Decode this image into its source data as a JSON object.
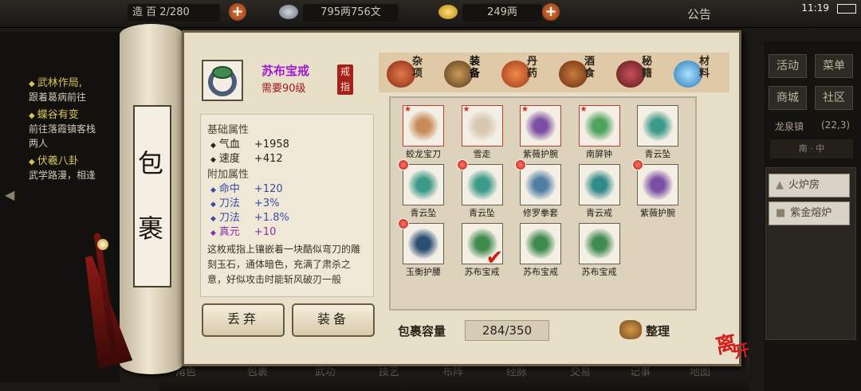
{
  "topbar": {
    "title_partial": "造 百",
    "capacity_partial": "2/280",
    "money": "795两756文",
    "gold": "249两",
    "announcement": "公告",
    "time": "11:19"
  },
  "quests": [
    {
      "title": "武林作局,",
      "desc": "跟着葛病前往"
    },
    {
      "title": "蝶谷有变",
      "desc": "前往落霞镇客栈",
      "desc2": "两人"
    },
    {
      "title": "伏羲八卦",
      "desc": "武学路漫，相逢"
    }
  ],
  "right_panel": {
    "buttons": [
      "活动",
      "菜单",
      "商城",
      "社区"
    ],
    "town": "龙泉镇",
    "town_coords": "(22,3)",
    "compass_south": "南",
    "compass_mid": "中",
    "slots": [
      "火炉房",
      "紫金熔炉"
    ]
  },
  "bottom_nav": [
    "角色",
    "包裹",
    "武功",
    "技艺",
    "布阵",
    "经脉",
    "交易",
    "记事",
    "地图"
  ],
  "scroll_title": [
    "包",
    "裹"
  ],
  "item": {
    "name": "苏布宝戒",
    "level_req": "需要90级",
    "type_seal": "戒指",
    "base_header": "基础属性",
    "base_stats": [
      {
        "name": "气血",
        "value": "+1958"
      },
      {
        "name": "速度",
        "value": "+412"
      }
    ],
    "extra_header": "附加属性",
    "extra_stats": [
      {
        "name": "命中",
        "value": "+120"
      },
      {
        "name": "刀法",
        "value": "+3%"
      },
      {
        "name": "刀法",
        "value": "+1.8%"
      },
      {
        "name": "真元",
        "value": "+10"
      }
    ],
    "description": "这枚戒指上镶嵌着一块酷似弯刀的雕刻玉石，通体暗色，充满了肃杀之意，好似攻击时能斩风破刃一般"
  },
  "buttons": {
    "discard": "丢弃",
    "equip": "装备"
  },
  "tabs": [
    {
      "label": "杂项",
      "color": "#b8462a"
    },
    {
      "label": "装备",
      "color": "#8b5a2b"
    },
    {
      "label": "丹药",
      "color": "#c86a3a"
    },
    {
      "label": "酒食",
      "color": "#9c4a1a"
    },
    {
      "label": "秘籍",
      "color": "#a2322a"
    },
    {
      "label": "材料",
      "color": "#4aa3d8"
    }
  ],
  "inventory": [
    {
      "name": "蛟龙宝刀",
      "icon": "saber-icon",
      "color": "#c98b5a",
      "star": true
    },
    {
      "name": "雪走",
      "icon": "katana-icon",
      "color": "#d8c7b0",
      "star": true
    },
    {
      "name": "紫薇护腕",
      "icon": "bracer-icon",
      "color": "#7b4fa3",
      "star": true
    },
    {
      "name": "南屏钟",
      "icon": "bell-icon",
      "color": "#4fa35c",
      "star": true
    },
    {
      "name": "青云坠",
      "icon": "pendant-icon",
      "color": "#3c9a8a",
      "star": false
    },
    {
      "name": "青云坠",
      "icon": "pendant-icon",
      "color": "#3c9a8a",
      "dot": true
    },
    {
      "name": "青云坠",
      "icon": "pendant-icon",
      "color": "#3c9a8a",
      "dot": true
    },
    {
      "name": "修罗拳套",
      "icon": "gauntlet-icon",
      "color": "#4f7fa3",
      "dot": true
    },
    {
      "name": "青云戒",
      "icon": "ring-icon",
      "color": "#2f8a8a",
      "dot": false
    },
    {
      "name": "紫薇护腕",
      "icon": "bracer-icon",
      "color": "#7b4fa3",
      "dot": true
    },
    {
      "name": "玉衡护腰",
      "icon": "belt-icon",
      "color": "#2b4f73",
      "dot": true
    },
    {
      "name": "苏布宝戒",
      "icon": "ring-icon",
      "color": "#3f8a4f",
      "selected": true
    },
    {
      "name": "苏布宝戒",
      "icon": "ring-icon",
      "color": "#3f8a4f"
    },
    {
      "name": "苏布宝戒",
      "icon": "ring-icon",
      "color": "#3f8a4f"
    }
  ],
  "capacity": {
    "label": "包裹容量",
    "value": "284/350"
  },
  "sort_label": "整理",
  "leave_label": [
    "离",
    "开"
  ]
}
